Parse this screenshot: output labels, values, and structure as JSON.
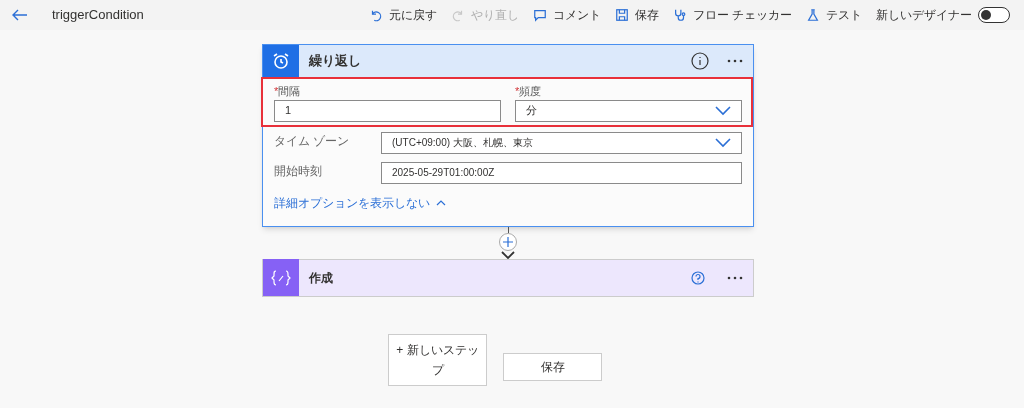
{
  "header": {
    "title": "triggerCondition",
    "toolbar": [
      {
        "kind": "undo",
        "label": "元に戻す",
        "disabled": false
      },
      {
        "kind": "redo",
        "label": "やり直し",
        "disabled": true
      },
      {
        "kind": "comment",
        "label": "コメント",
        "disabled": false
      },
      {
        "kind": "save",
        "label": "保存",
        "disabled": false
      },
      {
        "kind": "checker",
        "label": "フロー チェッカー",
        "disabled": false
      },
      {
        "kind": "test",
        "label": "テスト",
        "disabled": false
      }
    ],
    "new_designer": {
      "label": "新しいデザイナー",
      "on": false
    }
  },
  "trigger_card": {
    "title": "繰り返し",
    "highlighted": true,
    "top_fields": [
      {
        "label": "間隔",
        "required_mark": "*",
        "value": "1",
        "kind": "text"
      },
      {
        "label": "頻度",
        "required_mark": "*",
        "value": "分",
        "kind": "dropdown"
      }
    ],
    "side_fields": [
      {
        "label": "タイム ゾーン",
        "value": "(UTC+09:00) 大阪、札幌、東京",
        "kind": "dropdown"
      },
      {
        "label": "開始時刻",
        "value": "2025-05-29T01:00:00Z",
        "kind": "text"
      }
    ],
    "options_link": "詳細オプションを表示しない"
  },
  "action_card": {
    "title": "作成"
  },
  "buttons": {
    "new_step": "+ 新しいステップ",
    "save": "保存"
  }
}
